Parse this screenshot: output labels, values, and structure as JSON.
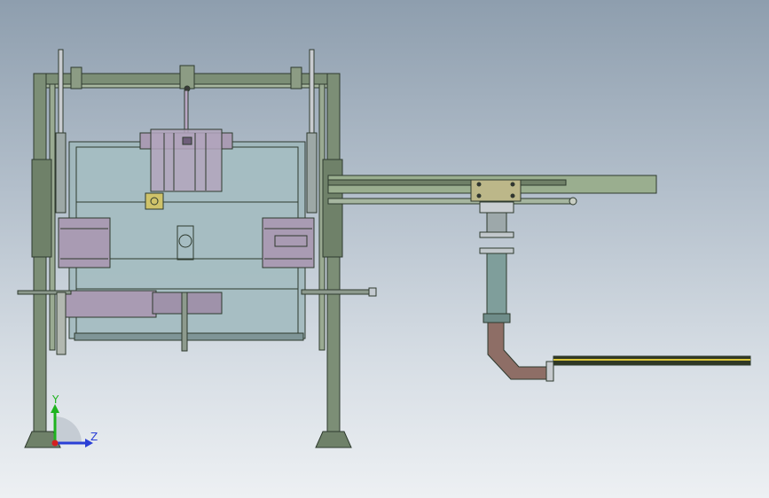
{
  "viewport": {
    "background_top": "#8e9eae",
    "background_bottom": "#edf0f3"
  },
  "colors": {
    "frame": "#7c8e76",
    "frame_dark": "#3c4a3c",
    "tank_glass": "#9fb7bb",
    "clamp_purple": "#a99bb3",
    "pipe_green": "#7f9e9b",
    "pipe_brown": "#8e6e66",
    "bracket_olive": "#bcb789",
    "rail_yellow": "#d9c43a"
  },
  "triad": {
    "y_label": "Y",
    "z_label": "Z",
    "y_color": "#1eb31e",
    "z_color": "#2a3fd6",
    "x_color": "#d42020"
  }
}
